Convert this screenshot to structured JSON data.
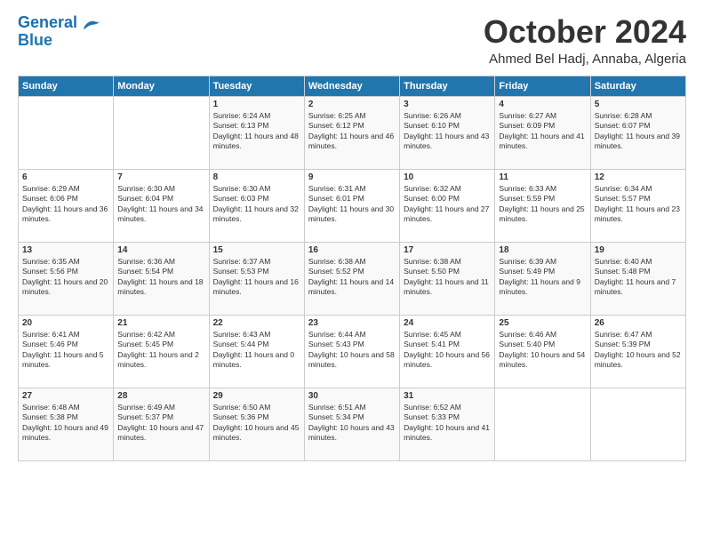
{
  "logo": {
    "line1": "General",
    "line2": "Blue"
  },
  "header": {
    "month": "October 2024",
    "location": "Ahmed Bel Hadj, Annaba, Algeria"
  },
  "weekdays": [
    "Sunday",
    "Monday",
    "Tuesday",
    "Wednesday",
    "Thursday",
    "Friday",
    "Saturday"
  ],
  "weeks": [
    [
      {
        "day": "",
        "sunrise": "",
        "sunset": "",
        "daylight": ""
      },
      {
        "day": "",
        "sunrise": "",
        "sunset": "",
        "daylight": ""
      },
      {
        "day": "1",
        "sunrise": "Sunrise: 6:24 AM",
        "sunset": "Sunset: 6:13 PM",
        "daylight": "Daylight: 11 hours and 48 minutes."
      },
      {
        "day": "2",
        "sunrise": "Sunrise: 6:25 AM",
        "sunset": "Sunset: 6:12 PM",
        "daylight": "Daylight: 11 hours and 46 minutes."
      },
      {
        "day": "3",
        "sunrise": "Sunrise: 6:26 AM",
        "sunset": "Sunset: 6:10 PM",
        "daylight": "Daylight: 11 hours and 43 minutes."
      },
      {
        "day": "4",
        "sunrise": "Sunrise: 6:27 AM",
        "sunset": "Sunset: 6:09 PM",
        "daylight": "Daylight: 11 hours and 41 minutes."
      },
      {
        "day": "5",
        "sunrise": "Sunrise: 6:28 AM",
        "sunset": "Sunset: 6:07 PM",
        "daylight": "Daylight: 11 hours and 39 minutes."
      }
    ],
    [
      {
        "day": "6",
        "sunrise": "Sunrise: 6:29 AM",
        "sunset": "Sunset: 6:06 PM",
        "daylight": "Daylight: 11 hours and 36 minutes."
      },
      {
        "day": "7",
        "sunrise": "Sunrise: 6:30 AM",
        "sunset": "Sunset: 6:04 PM",
        "daylight": "Daylight: 11 hours and 34 minutes."
      },
      {
        "day": "8",
        "sunrise": "Sunrise: 6:30 AM",
        "sunset": "Sunset: 6:03 PM",
        "daylight": "Daylight: 11 hours and 32 minutes."
      },
      {
        "day": "9",
        "sunrise": "Sunrise: 6:31 AM",
        "sunset": "Sunset: 6:01 PM",
        "daylight": "Daylight: 11 hours and 30 minutes."
      },
      {
        "day": "10",
        "sunrise": "Sunrise: 6:32 AM",
        "sunset": "Sunset: 6:00 PM",
        "daylight": "Daylight: 11 hours and 27 minutes."
      },
      {
        "day": "11",
        "sunrise": "Sunrise: 6:33 AM",
        "sunset": "Sunset: 5:59 PM",
        "daylight": "Daylight: 11 hours and 25 minutes."
      },
      {
        "day": "12",
        "sunrise": "Sunrise: 6:34 AM",
        "sunset": "Sunset: 5:57 PM",
        "daylight": "Daylight: 11 hours and 23 minutes."
      }
    ],
    [
      {
        "day": "13",
        "sunrise": "Sunrise: 6:35 AM",
        "sunset": "Sunset: 5:56 PM",
        "daylight": "Daylight: 11 hours and 20 minutes."
      },
      {
        "day": "14",
        "sunrise": "Sunrise: 6:36 AM",
        "sunset": "Sunset: 5:54 PM",
        "daylight": "Daylight: 11 hours and 18 minutes."
      },
      {
        "day": "15",
        "sunrise": "Sunrise: 6:37 AM",
        "sunset": "Sunset: 5:53 PM",
        "daylight": "Daylight: 11 hours and 16 minutes."
      },
      {
        "day": "16",
        "sunrise": "Sunrise: 6:38 AM",
        "sunset": "Sunset: 5:52 PM",
        "daylight": "Daylight: 11 hours and 14 minutes."
      },
      {
        "day": "17",
        "sunrise": "Sunrise: 6:38 AM",
        "sunset": "Sunset: 5:50 PM",
        "daylight": "Daylight: 11 hours and 11 minutes."
      },
      {
        "day": "18",
        "sunrise": "Sunrise: 6:39 AM",
        "sunset": "Sunset: 5:49 PM",
        "daylight": "Daylight: 11 hours and 9 minutes."
      },
      {
        "day": "19",
        "sunrise": "Sunrise: 6:40 AM",
        "sunset": "Sunset: 5:48 PM",
        "daylight": "Daylight: 11 hours and 7 minutes."
      }
    ],
    [
      {
        "day": "20",
        "sunrise": "Sunrise: 6:41 AM",
        "sunset": "Sunset: 5:46 PM",
        "daylight": "Daylight: 11 hours and 5 minutes."
      },
      {
        "day": "21",
        "sunrise": "Sunrise: 6:42 AM",
        "sunset": "Sunset: 5:45 PM",
        "daylight": "Daylight: 11 hours and 2 minutes."
      },
      {
        "day": "22",
        "sunrise": "Sunrise: 6:43 AM",
        "sunset": "Sunset: 5:44 PM",
        "daylight": "Daylight: 11 hours and 0 minutes."
      },
      {
        "day": "23",
        "sunrise": "Sunrise: 6:44 AM",
        "sunset": "Sunset: 5:43 PM",
        "daylight": "Daylight: 10 hours and 58 minutes."
      },
      {
        "day": "24",
        "sunrise": "Sunrise: 6:45 AM",
        "sunset": "Sunset: 5:41 PM",
        "daylight": "Daylight: 10 hours and 56 minutes."
      },
      {
        "day": "25",
        "sunrise": "Sunrise: 6:46 AM",
        "sunset": "Sunset: 5:40 PM",
        "daylight": "Daylight: 10 hours and 54 minutes."
      },
      {
        "day": "26",
        "sunrise": "Sunrise: 6:47 AM",
        "sunset": "Sunset: 5:39 PM",
        "daylight": "Daylight: 10 hours and 52 minutes."
      }
    ],
    [
      {
        "day": "27",
        "sunrise": "Sunrise: 6:48 AM",
        "sunset": "Sunset: 5:38 PM",
        "daylight": "Daylight: 10 hours and 49 minutes."
      },
      {
        "day": "28",
        "sunrise": "Sunrise: 6:49 AM",
        "sunset": "Sunset: 5:37 PM",
        "daylight": "Daylight: 10 hours and 47 minutes."
      },
      {
        "day": "29",
        "sunrise": "Sunrise: 6:50 AM",
        "sunset": "Sunset: 5:36 PM",
        "daylight": "Daylight: 10 hours and 45 minutes."
      },
      {
        "day": "30",
        "sunrise": "Sunrise: 6:51 AM",
        "sunset": "Sunset: 5:34 PM",
        "daylight": "Daylight: 10 hours and 43 minutes."
      },
      {
        "day": "31",
        "sunrise": "Sunrise: 6:52 AM",
        "sunset": "Sunset: 5:33 PM",
        "daylight": "Daylight: 10 hours and 41 minutes."
      },
      {
        "day": "",
        "sunrise": "",
        "sunset": "",
        "daylight": ""
      },
      {
        "day": "",
        "sunrise": "",
        "sunset": "",
        "daylight": ""
      }
    ]
  ]
}
